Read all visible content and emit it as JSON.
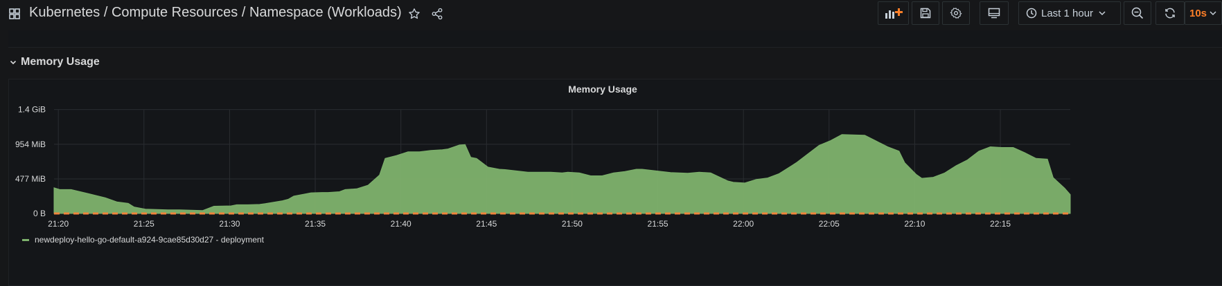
{
  "header": {
    "title": "Kubernetes / Compute Resources / Namespace (Workloads)",
    "time_range": "Last 1 hour",
    "refresh_interval": "10s",
    "accent_color": "#ff7f28"
  },
  "icons": {
    "grid": "grid-icon",
    "star": "star-icon",
    "share": "share-icon",
    "add_panel": "add-panel-icon",
    "save": "save-icon",
    "settings": "gear-icon",
    "tv_mode": "monitor-icon",
    "clock": "clock-icon",
    "zoom_out": "zoom-out-icon",
    "refresh": "refresh-icon",
    "chevron": "chevron-down-icon"
  },
  "row": {
    "title": "Memory Usage"
  },
  "panel": {
    "title": "Memory Usage"
  },
  "chart_data": {
    "type": "area",
    "title": "Memory Usage",
    "xlabel": "",
    "ylabel": "",
    "y_ticks": [
      "0 B",
      "477 MiB",
      "954 MiB",
      "1.4 GiB"
    ],
    "y_range_mib": [
      0,
      1430
    ],
    "x_ticks": [
      "21:20",
      "21:25",
      "21:30",
      "21:35",
      "21:40",
      "21:45",
      "21:50",
      "21:55",
      "22:00",
      "22:05",
      "22:10",
      "22:15"
    ],
    "x_range": [
      "21:19:45",
      "22:19:05"
    ],
    "grid": true,
    "legend_position": "bottom-left",
    "series": [
      {
        "name": "newdeploy-hello-go-default-a924-9cae85d30d27 - deployment",
        "color": "#7eb26d",
        "unit": "MiB",
        "x": [
          "21:19:45",
          "21:20:05",
          "21:20:45",
          "21:21:45",
          "21:22:45",
          "21:23:25",
          "21:24:05",
          "21:24:25",
          "21:25:05",
          "21:26:25",
          "21:26:45",
          "21:27:05",
          "21:28:25",
          "21:29:05",
          "21:30:05",
          "21:30:25",
          "21:31:05",
          "21:31:45",
          "21:32:05",
          "21:33:05",
          "21:33:25",
          "21:33:45",
          "21:34:25",
          "21:34:45",
          "21:35:25",
          "21:35:45",
          "21:36:25",
          "21:36:45",
          "21:37:25",
          "21:38:05",
          "21:38:45",
          "21:39:05",
          "21:39:45",
          "21:40:25",
          "21:41:05",
          "21:41:45",
          "21:42:25",
          "21:42:45",
          "21:43:25",
          "21:43:45",
          "21:44:05",
          "21:44:25",
          "21:45:05",
          "21:45:45",
          "21:46:05",
          "21:47:25",
          "21:47:45",
          "21:48:25",
          "21:48:45",
          "21:49:25",
          "21:49:45",
          "21:50:25",
          "21:51:05",
          "21:51:45",
          "21:52:25",
          "21:53:05",
          "21:53:45",
          "21:54:05",
          "21:55:45",
          "21:56:45",
          "21:57:25",
          "21:58:05",
          "21:59:05",
          "21:59:25",
          "22:00:05",
          "22:00:45",
          "22:01:25",
          "22:02:05",
          "22:03:05",
          "22:03:45",
          "22:04:25",
          "22:05:05",
          "22:05:45",
          "22:06:25",
          "22:07:05",
          "22:07:45",
          "22:08:25",
          "22:09:05",
          "22:09:25",
          "22:10:05",
          "22:10:25",
          "22:11:05",
          "22:11:45",
          "22:12:25",
          "22:13:05",
          "22:13:45",
          "22:14:25",
          "22:15:05",
          "22:15:45",
          "22:16:25",
          "22:17:05",
          "22:17:45",
          "22:18:05",
          "22:18:45",
          "22:19:05"
        ],
        "y": [
          355,
          330,
          330,
          275,
          215,
          160,
          140,
          90,
          60,
          50,
          50,
          50,
          40,
          100,
          105,
          120,
          120,
          125,
          135,
          175,
          195,
          240,
          270,
          285,
          290,
          290,
          300,
          330,
          340,
          390,
          530,
          760,
          800,
          850,
          850,
          870,
          880,
          890,
          945,
          950,
          775,
          760,
          640,
          610,
          605,
          570,
          570,
          570,
          570,
          560,
          570,
          560,
          520,
          520,
          560,
          580,
          610,
          610,
          565,
          555,
          570,
          560,
          450,
          430,
          420,
          470,
          490,
          550,
          700,
          820,
          940,
          1005,
          1090,
          1085,
          1080,
          1000,
          920,
          860,
          700,
          540,
          485,
          500,
          560,
          660,
          740,
          860,
          920,
          910,
          910,
          840,
          760,
          750,
          495,
          350,
          260
        ]
      },
      {
        "name": "",
        "color": "#ef843c",
        "dashed": true,
        "unit": "MiB",
        "x": [
          "21:19:45",
          "22:19:05"
        ],
        "y": [
          0,
          0
        ]
      }
    ]
  }
}
